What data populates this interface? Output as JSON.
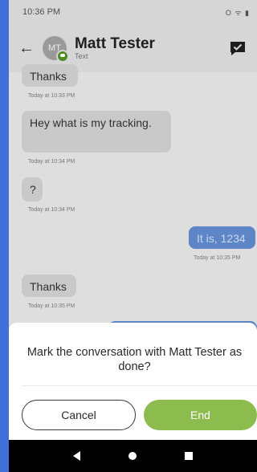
{
  "status": {
    "time": "10:36 PM",
    "icons": "O ᯤ ▮"
  },
  "header": {
    "avatar_initials": "MT",
    "title": "Matt Tester",
    "subtitle": "Text"
  },
  "messages": [
    {
      "text": "Thanks",
      "time": "Today at 10:33 PM",
      "direction": "in"
    },
    {
      "text": "Hey what is my tracking.",
      "time": "Today at 10:34 PM",
      "direction": "in"
    },
    {
      "text": "?",
      "time": "Today at 10:34 PM",
      "direction": "in"
    },
    {
      "text": "It is, 1234",
      "time": "Today at 10:35 PM",
      "direction": "out"
    },
    {
      "text": "Thanks",
      "time": "Today at 10:35 PM",
      "direction": "in"
    }
  ],
  "dialog": {
    "message": "Mark the conversation with Matt Tester as done?",
    "cancel_label": "Cancel",
    "end_label": "End"
  },
  "colors": {
    "accent": "#8cbc4e",
    "frame": "#3f6fd8"
  }
}
